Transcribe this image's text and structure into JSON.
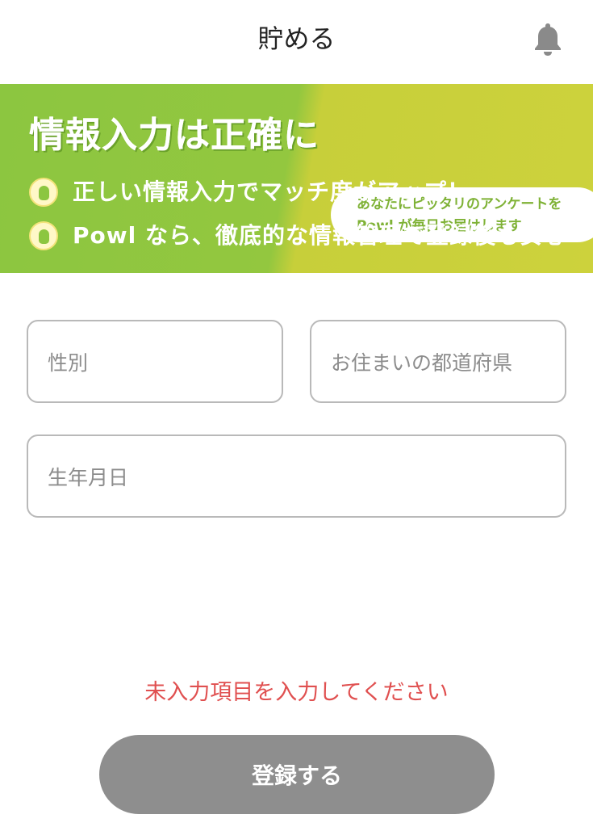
{
  "header": {
    "title": "貯める",
    "notification_icon": "bell-icon"
  },
  "banner": {
    "title": "情報入力は正確に",
    "bubble_line1": "あなたにピッタリのアンケートを",
    "bubble_line2": "Powl が毎日お届けします",
    "points": [
      "正しい情報入力でマッチ度がアップ！",
      "Powl なら、徹底的な情報管理で登録後も安心"
    ],
    "colors": {
      "green": "#8cc640",
      "lime": "#cdd23c"
    }
  },
  "form": {
    "gender_placeholder": "性別",
    "prefecture_placeholder": "お住まいの都道府県",
    "birthdate_placeholder": "生年月日"
  },
  "error_message": "未入力項目を入力してください",
  "submit_label": "登録する",
  "colors": {
    "error": "#e05050",
    "button_disabled": "#8e8e8e"
  }
}
